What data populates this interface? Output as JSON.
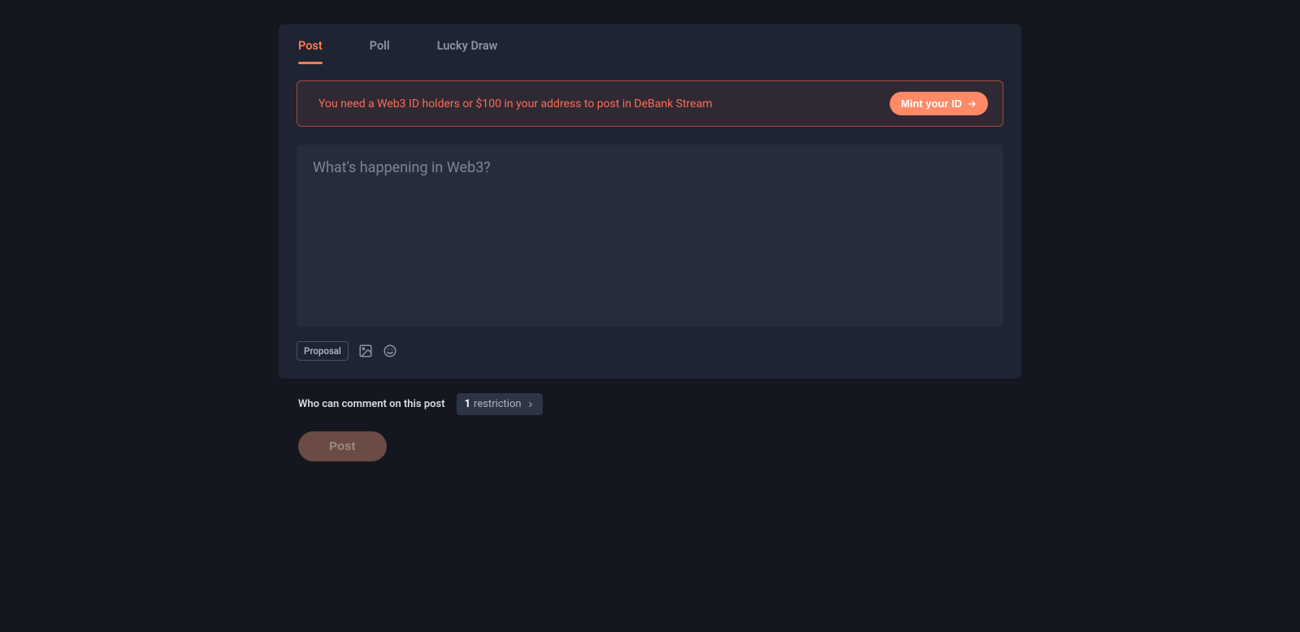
{
  "tabs": {
    "post": "Post",
    "poll": "Poll",
    "luckyDraw": "Lucky Draw"
  },
  "warning": {
    "text": "You need a Web3 ID holders or $100 in your address to post in DeBank Stream",
    "mintLabel": "Mint your ID"
  },
  "composer": {
    "placeholder": "What's happening in Web3?"
  },
  "tools": {
    "proposalLabel": "Proposal"
  },
  "commentControl": {
    "label": "Who can comment on this post",
    "count": "1",
    "text": "restriction"
  },
  "submit": {
    "label": "Post"
  }
}
